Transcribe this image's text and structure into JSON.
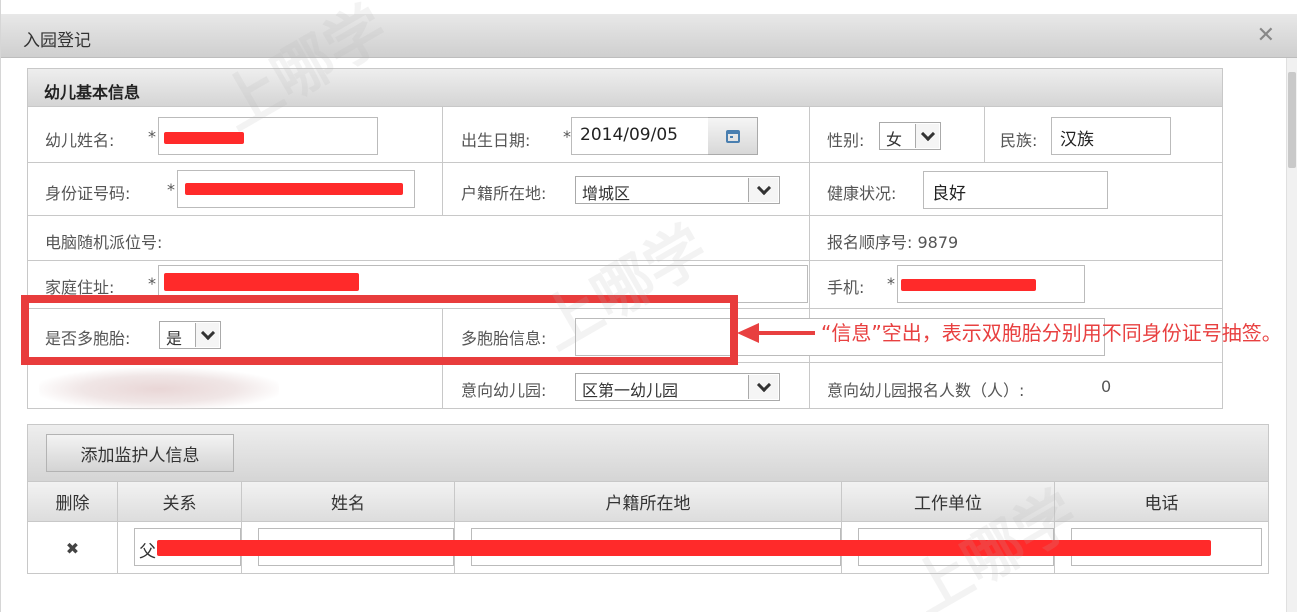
{
  "dialog": {
    "title": "入园登记",
    "close_icon": "close-icon"
  },
  "basic": {
    "section_title": "幼儿基本信息",
    "name_label": "幼儿姓名:",
    "birth_label": "出生日期:",
    "birth_value": "2014/09/05",
    "gender_label": "性别:",
    "gender_value": "女",
    "ethnicity_label": "民族:",
    "ethnicity_value": "汉族",
    "id_label": "身份证号码:",
    "hukou_label": "户籍所在地:",
    "hukou_value": "增城区",
    "health_label": "健康状况:",
    "health_value": "良好",
    "random_label": "电脑随机派位号:",
    "signup_label": "报名顺序号: 9879",
    "address_label": "家庭住址:",
    "phone_label": "手机:",
    "multi_label": "是否多胞胎:",
    "multi_value": "是",
    "multi_info_label": "多胞胎信息:",
    "kindergarten_label": "意向幼儿园:",
    "kindergarten_value": "区第一幼儿园",
    "kg_count_label": "意向幼儿园报名人数（人）:",
    "kg_count_value": "0",
    "required_mark": "*"
  },
  "annotation": {
    "note": "“信息”空出，表示双胞胎分别用不同身份证号抽签。"
  },
  "guardian": {
    "add_button": "添加监护人信息",
    "columns": [
      "删除",
      "关系",
      "姓名",
      "户籍所在地",
      "工作单位",
      "电话"
    ],
    "row": {
      "delete": "✖",
      "relation": "父"
    }
  },
  "watermark": "上哪学",
  "colors": {
    "highlight": "#e83c3c",
    "redaction": "#ff2a2a"
  }
}
